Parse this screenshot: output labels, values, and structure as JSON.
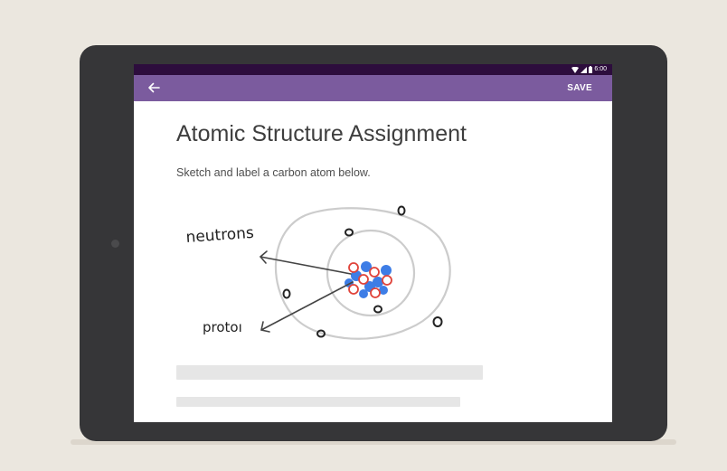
{
  "status_bar": {
    "time": "6:00",
    "icons": [
      "wifi-icon",
      "cell-signal-icon",
      "battery-icon"
    ]
  },
  "toolbar": {
    "back_icon": "arrow-left-icon",
    "save_label": "SAVE"
  },
  "assignment": {
    "title": "Atomic Structure Assignment",
    "instructions": "Sketch and label a carbon atom below."
  },
  "sketch": {
    "label_neutrons": "neutrons",
    "label_protons": "protoı",
    "colors": {
      "ink": "#222222",
      "orbit": "#cccccc",
      "neutron": "#3d7de6",
      "proton": "#e0433a"
    }
  },
  "colors": {
    "toolbar": "#7b5b9e",
    "status_bar": "#2d0d3d",
    "device_frame": "#363638",
    "background": "#ebe7df"
  }
}
